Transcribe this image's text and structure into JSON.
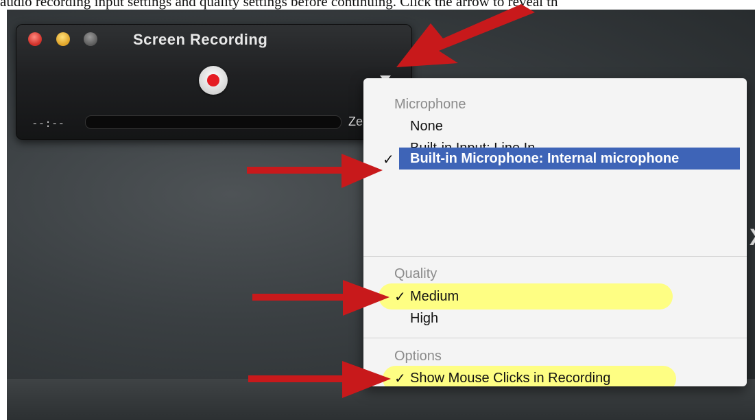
{
  "caption": "audio recording input settings and quality settings before continuing. Click the arrow to reveal th",
  "window": {
    "title": "Screen Recording",
    "elapsed_time": "--:--",
    "size_label": "Zero"
  },
  "menu": {
    "microphone": {
      "heading": "Microphone",
      "options": [
        "None",
        "Built-in Input: Line In",
        "Built-in Microphone: Internal microphone"
      ],
      "selected": "Built-in Microphone: Internal microphone"
    },
    "quality": {
      "heading": "Quality",
      "options": [
        "Medium",
        "High"
      ],
      "selected": "Medium"
    },
    "options": {
      "heading": "Options",
      "items": [
        "Show Mouse Clicks in Recording"
      ],
      "checked": "Show Mouse Clicks in Recording"
    },
    "check_mark": "✓"
  },
  "edge_glyph": "X",
  "colors": {
    "annotation_arrow": "#c8191b",
    "highlight": "#ffff6e",
    "selection": "#3e64b7"
  }
}
